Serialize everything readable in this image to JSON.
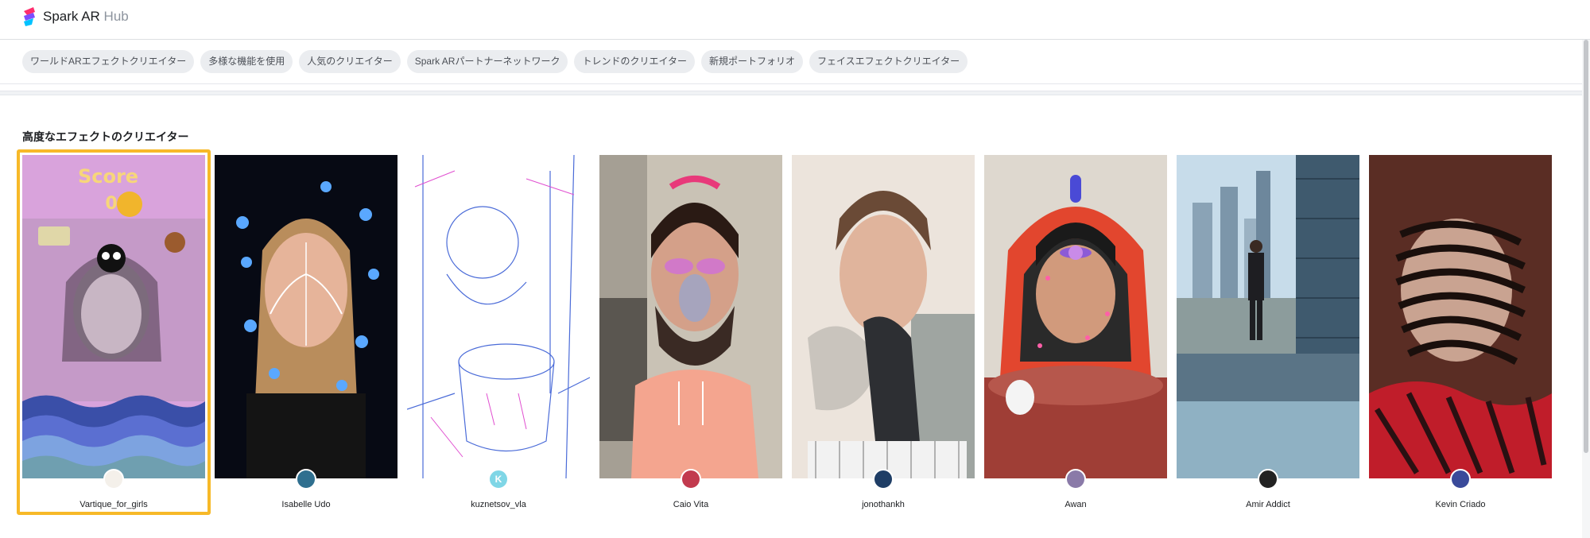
{
  "header": {
    "brand_name": "Spark AR",
    "brand_suffix": "Hub"
  },
  "filters": [
    "ワールドARエフェクトクリエイター",
    "多様な機能を使用",
    "人気のクリエイター",
    "Spark ARパートナーネットワーク",
    "トレンドのクリエイター",
    "新規ポートフォリオ",
    "フェイスエフェクトクリエイター"
  ],
  "section": {
    "title": "高度なエフェクトのクリエイター"
  },
  "cards": [
    {
      "name": "Vartique_for_girls",
      "avatar_icon": "brand-logo-avatar",
      "selected": true,
      "overlay_text": "Score",
      "score_value": "0"
    },
    {
      "name": "Isabelle Udo",
      "avatar_icon": "user-photo-avatar"
    },
    {
      "name": "kuznetsov_vla",
      "avatar_letter": "K"
    },
    {
      "name": "Caio Vita",
      "avatar_icon": "user-photo-avatar"
    },
    {
      "name": "jonothankh",
      "avatar_icon": "user-photo-avatar"
    },
    {
      "name": "Awan",
      "avatar_icon": "user-photo-avatar"
    },
    {
      "name": "Amir Addict",
      "avatar_icon": "user-photo-avatar"
    },
    {
      "name": "Kevin Criado",
      "avatar_icon": "user-photo-avatar"
    }
  ],
  "colors": {
    "selection": "#f7b928",
    "chip_bg": "#ebedf0",
    "accent": "#1877f2"
  }
}
